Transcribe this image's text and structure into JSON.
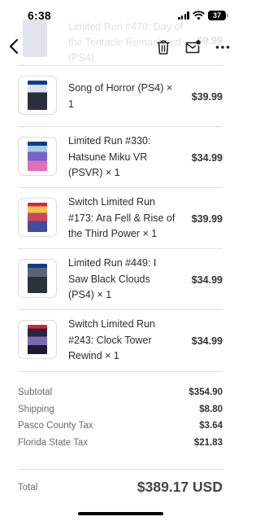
{
  "status_bar": {
    "time": "6:38",
    "battery": "37"
  },
  "faded_item": {
    "name": "Limited Run #470: Day of the Tentacle Remastered (PS4)",
    "price": "$9.99"
  },
  "nav": {
    "back_icon": "chevron-left-icon",
    "actions": [
      "trash-icon",
      "mail-icon",
      "more-icon"
    ]
  },
  "items": [
    {
      "name": "Song of Horror (PS4) × 1",
      "price": "$39.99",
      "art_color": "#cfd8e8",
      "band_color": "#0d3c8c"
    },
    {
      "name": "Limited Run #330: Hatsune Miku VR (PSVR) × 1",
      "price": "$34.99",
      "art_color": "#6f5fc5",
      "band_color": "#0d3c8c"
    },
    {
      "name": "Switch Limited Run #173: Ara Fell & Rise of the Third Power × 1",
      "price": "$39.99",
      "art_color": "#c7485a",
      "band_color": "#d3283a"
    },
    {
      "name": "Limited Run #449: I Saw Black Clouds (PS4) × 1",
      "price": "$34.99",
      "art_color": "#3a3f4a",
      "band_color": "#0d3c8c"
    },
    {
      "name": "Switch Limited Run #243: Clock Tower Rewind × 1",
      "price": "$34.99",
      "art_color": "#5a4a86",
      "band_color": "#d3283a"
    }
  ],
  "totals": [
    {
      "label": "Subtotal",
      "value": "$354.90"
    },
    {
      "label": "Shipping",
      "value": "$8.80"
    },
    {
      "label": "Pasco County Tax",
      "value": "$3.64"
    },
    {
      "label": "Florida State Tax",
      "value": "$21.83"
    }
  ],
  "grand_total": {
    "label": "Total",
    "value": "$389.17 USD"
  }
}
